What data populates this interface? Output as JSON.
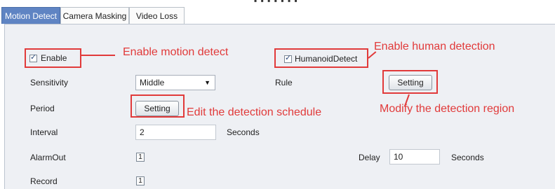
{
  "top_partial_text": "▪ ▪ ▪ ▪ ▪ ▪ ▪",
  "tabs": [
    {
      "label": "Motion Detect",
      "active": true
    },
    {
      "label": "Camera Masking",
      "active": false
    },
    {
      "label": "Video Loss",
      "active": false
    }
  ],
  "enable": {
    "label": "Enable",
    "checked": true
  },
  "humanoid": {
    "label": "HumanoidDetect",
    "checked": true
  },
  "sensitivity": {
    "label": "Sensitivity",
    "value": "Middle"
  },
  "rule": {
    "label": "Rule",
    "button": "Setting"
  },
  "period": {
    "label": "Period",
    "button": "Setting"
  },
  "interval": {
    "label": "Interval",
    "value": "2",
    "unit": "Seconds"
  },
  "alarmout": {
    "label": "AlarmOut",
    "channel": "1"
  },
  "delay": {
    "label": "Delay",
    "value": "10",
    "unit": "Seconds"
  },
  "record": {
    "label": "Record",
    "channel": "1"
  },
  "annotations": {
    "enable_motion": "Enable motion detect",
    "enable_human": "Enable human detection",
    "edit_schedule": "Edit the detection schedule",
    "modify_region": "Modify the detection region"
  },
  "colors": {
    "annotation": "#e13a3a",
    "active_tab": "#5f84c3",
    "panel": "#eef0f4"
  }
}
